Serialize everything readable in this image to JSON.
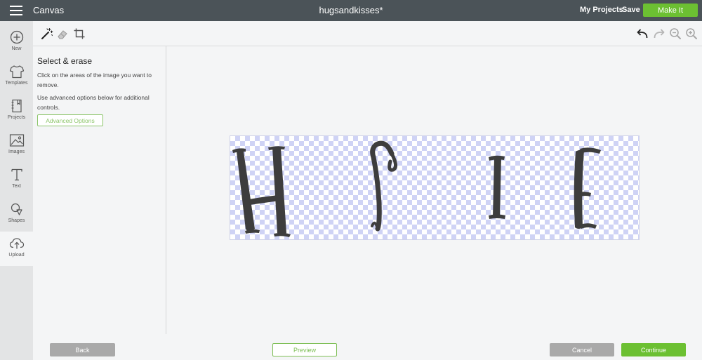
{
  "topbar": {
    "app_title": "Canvas",
    "project_name": "hugsandkisses*",
    "my_projects": "My Projects",
    "save": "Save",
    "make_it": "Make It"
  },
  "rail": {
    "items": [
      {
        "label": "New",
        "icon": "plus-circle-icon"
      },
      {
        "label": "Templates",
        "icon": "tshirt-icon"
      },
      {
        "label": "Projects",
        "icon": "notebook-icon"
      },
      {
        "label": "Images",
        "icon": "image-icon"
      },
      {
        "label": "Text",
        "icon": "text-icon"
      },
      {
        "label": "Shapes",
        "icon": "shapes-icon"
      },
      {
        "label": "Upload",
        "icon": "cloud-upload-icon"
      }
    ],
    "active": "Upload"
  },
  "toolbar": {
    "left_tools": [
      "magic-wand-icon",
      "eraser-icon",
      "crop-icon"
    ],
    "right_tools": [
      "undo-icon",
      "redo-icon",
      "zoom-out-icon",
      "zoom-in-icon"
    ]
  },
  "panel": {
    "title": "Select & erase",
    "text1": "Click on the areas of the image you want to remove.",
    "text2": "Use advanced options below for additional controls.",
    "advanced_options": "Advanced Options"
  },
  "artwork": {
    "letters": [
      "H",
      "S",
      "I",
      "E"
    ],
    "letter_color": "#3d3d3d",
    "checker_color": "#cfd3f5"
  },
  "bottombar": {
    "back": "Back",
    "preview": "Preview",
    "cancel": "Cancel",
    "continue": "Continue"
  },
  "colors": {
    "topbar": "#4b5358",
    "accent": "#6cc032",
    "rail": "#e3e4e5"
  }
}
